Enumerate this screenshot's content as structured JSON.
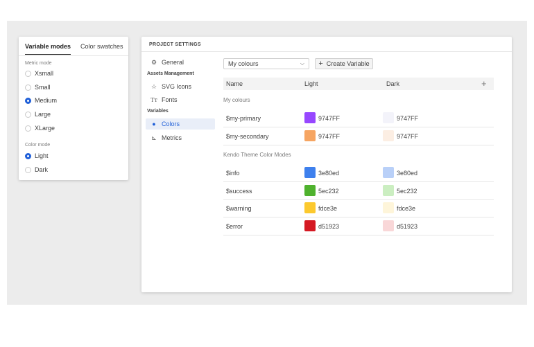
{
  "left_panel": {
    "tabs": [
      {
        "label": "Variable modes",
        "active": true
      },
      {
        "label": "Color swatches",
        "active": false
      }
    ],
    "groups": [
      {
        "label": "Metric mode",
        "options": [
          {
            "label": "Xsmall",
            "checked": false
          },
          {
            "label": "Small",
            "checked": false
          },
          {
            "label": "Medium",
            "checked": true
          },
          {
            "label": "Large",
            "checked": false
          },
          {
            "label": "XLarge",
            "checked": false
          }
        ]
      },
      {
        "label": "Color mode",
        "options": [
          {
            "label": "Light",
            "checked": true
          },
          {
            "label": "Dark",
            "checked": false
          }
        ]
      }
    ]
  },
  "right_panel": {
    "title": "PROJECT SETTINGS",
    "nav": {
      "general": {
        "label": "General",
        "icon": "gear-icon"
      },
      "assets_title": "Assets Management",
      "svg_icons": {
        "label": "SVG Icons",
        "icon": "star-icon"
      },
      "fonts": {
        "label": "Fonts",
        "icon": "text-icon"
      },
      "variables_title": "Variables",
      "colors": {
        "label": "Colors",
        "icon": "palette-icon",
        "active": true
      },
      "metrics": {
        "label": "Metrics",
        "icon": "ruler-icon"
      }
    },
    "toolbar": {
      "select_value": "My colours",
      "create_label": "Create Variable"
    },
    "table": {
      "headers": {
        "name": "Name",
        "light": "Light",
        "dark": "Dark"
      },
      "groups": [
        {
          "title": "My colours",
          "rows": [
            {
              "name": "$my-primary",
              "light": {
                "color": "#9747FF",
                "label": "9747FF"
              },
              "dark": {
                "color": "#F3F3FA",
                "label": "9747FF"
              }
            },
            {
              "name": "$my-secondary",
              "light": {
                "color": "#F6A562",
                "label": "9747FF"
              },
              "dark": {
                "color": "#FCEEE3",
                "label": "9747FF"
              }
            }
          ]
        },
        {
          "title": "Kendo Theme Color Modes",
          "rows": [
            {
              "name": "$info",
              "light": {
                "color": "#3E80ED",
                "label": "3e80ed"
              },
              "dark": {
                "color": "#B9D0F8",
                "label": "3e80ed"
              }
            },
            {
              "name": "$success",
              "light": {
                "color": "#4FB22E",
                "label": "5ec232"
              },
              "dark": {
                "color": "#CBEEC1",
                "label": "5ec232"
              }
            },
            {
              "name": "$warning",
              "light": {
                "color": "#FCC92E",
                "label": "fdce3e"
              },
              "dark": {
                "color": "#FEF5DA",
                "label": "fdce3e"
              }
            },
            {
              "name": "$error",
              "light": {
                "color": "#D51923",
                "label": "d51923"
              },
              "dark": {
                "color": "#F9D7D8",
                "label": "d51923"
              }
            }
          ]
        }
      ]
    }
  },
  "colors": {
    "accent": "#1F5FD8",
    "canvas": "#ECECEC"
  }
}
